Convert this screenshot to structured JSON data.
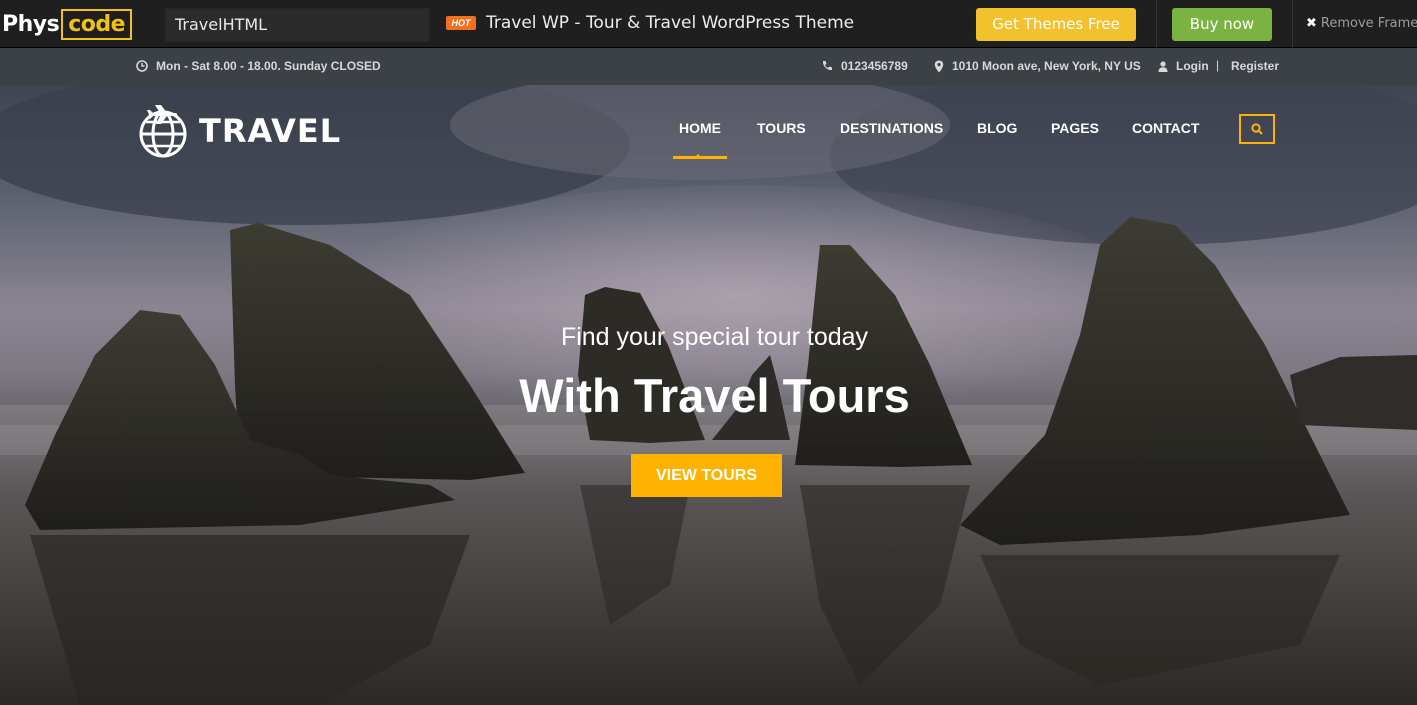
{
  "framebar": {
    "logo_part1": "Phys",
    "logo_part2": "code",
    "theme_select_value": "TravelHTML",
    "hot_badge": "HOT",
    "theme_title": "Travel WP - Tour & Travel WordPress Theme",
    "get_themes_label": "Get Themes Free",
    "buy_now_label": "Buy now",
    "remove_frame_label": "Remove Frame",
    "colors": {
      "accent": "#f3c018",
      "get_button": "#f2c12e",
      "buy_button": "#7ab342"
    }
  },
  "topbar": {
    "hours": "Mon - Sat 8.00 - 18.00. Sunday CLOSED",
    "phone": "0123456789",
    "address": "1010 Moon ave, New York, NY US",
    "login": "Login",
    "divider": "|",
    "register": "Register",
    "icons": [
      "clock-icon",
      "phone-icon",
      "map-pin-icon",
      "user-icon"
    ]
  },
  "header": {
    "logo_text": "TRAVEL",
    "nav": [
      {
        "label": "HOME",
        "active": true
      },
      {
        "label": "TOURS",
        "active": false
      },
      {
        "label": "DESTINATIONS",
        "active": false
      },
      {
        "label": "BLOG",
        "active": false
      },
      {
        "label": "PAGES",
        "active": false
      },
      {
        "label": "CONTACT",
        "active": false
      }
    ],
    "search_icon": "search-icon",
    "accent_color": "#ffb300"
  },
  "hero": {
    "subtitle": "Find your special tour today",
    "title": "With Travel Tours",
    "button_label": "VIEW TOURS"
  }
}
